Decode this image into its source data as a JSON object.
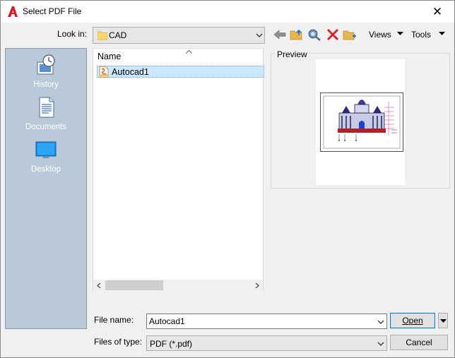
{
  "window": {
    "title": "Select PDF File",
    "app_icon": "autocad-a-logo",
    "close_icon": "close-icon"
  },
  "toolbar": {
    "look_in_label": "Look in:",
    "look_in_value": "CAD",
    "views_label": "Views",
    "tools_label": "Tools",
    "icons": [
      "back-arrow-icon",
      "up-folder-icon",
      "search-web-icon",
      "delete-icon",
      "new-folder-icon"
    ]
  },
  "places": [
    {
      "label": "History",
      "icon": "history-icon"
    },
    {
      "label": "Documents",
      "icon": "documents-icon"
    },
    {
      "label": "Desktop",
      "icon": "desktop-icon"
    }
  ],
  "file_list": {
    "column_name": "Name",
    "files": [
      {
        "name": "Autocad1",
        "icon": "pdf-file-icon",
        "selected": true
      }
    ]
  },
  "preview": {
    "label": "Preview"
  },
  "form": {
    "file_name_label": "File name:",
    "file_name_value": "Autocad1",
    "file_type_label": "Files of type:",
    "file_type_value": "PDF (*.pdf)",
    "open_label": "Open",
    "cancel_label": "Cancel"
  },
  "colors": {
    "accent": "#0078d7",
    "places_bg": "#b9c9d9",
    "selection": "#cce8ff",
    "autocad_red": "#d01f2a"
  }
}
